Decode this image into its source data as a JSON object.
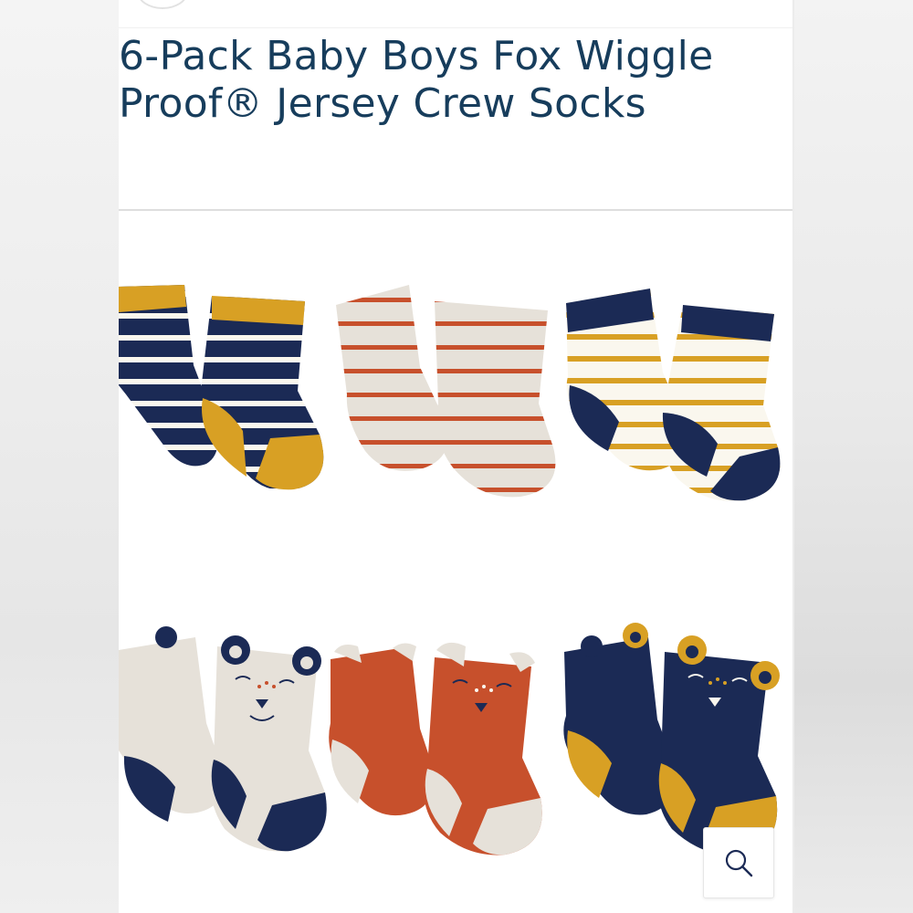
{
  "product": {
    "title": "6-Pack Baby Boys Fox Wiggle Proof® Jersey Crew Socks"
  },
  "gallery": {
    "zoom_icon": "magnifier-icon"
  },
  "colors": {
    "title": "#173d5c",
    "navy": "#1b2a55",
    "mustard": "#d8a024",
    "rust": "#c7502c",
    "oatmeal": "#e6e1d9",
    "cream": "#faf7ee"
  }
}
